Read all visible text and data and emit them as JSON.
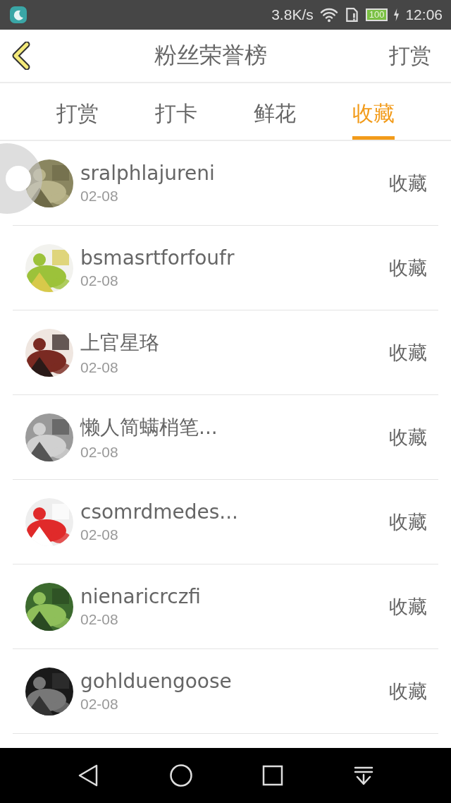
{
  "status_bar": {
    "network_speed": "3.8K/s",
    "battery": "100",
    "time": "12:06"
  },
  "header": {
    "title": "粉丝荣誉榜",
    "action": "打赏"
  },
  "tabs": [
    {
      "label": "打赏",
      "selected": false
    },
    {
      "label": "打卡",
      "selected": false
    },
    {
      "label": "鲜花",
      "selected": false
    },
    {
      "label": "收藏",
      "selected": true
    }
  ],
  "fans": [
    {
      "name": "sralphlajureni",
      "date": "02-08",
      "action": "收藏"
    },
    {
      "name": "bsmasrtforfoufr",
      "date": "02-08",
      "action": "收藏"
    },
    {
      "name": "上官星珞",
      "date": "02-08",
      "action": "收藏"
    },
    {
      "name": "懒人简螨梢笔...",
      "date": "02-08",
      "action": "收藏"
    },
    {
      "name": "csomrdmedes...",
      "date": "02-08",
      "action": "收藏"
    },
    {
      "name": "nienaricrczfi",
      "date": "02-08",
      "action": "收藏"
    },
    {
      "name": "gohlduengoose",
      "date": "02-08",
      "action": "收藏"
    }
  ]
}
